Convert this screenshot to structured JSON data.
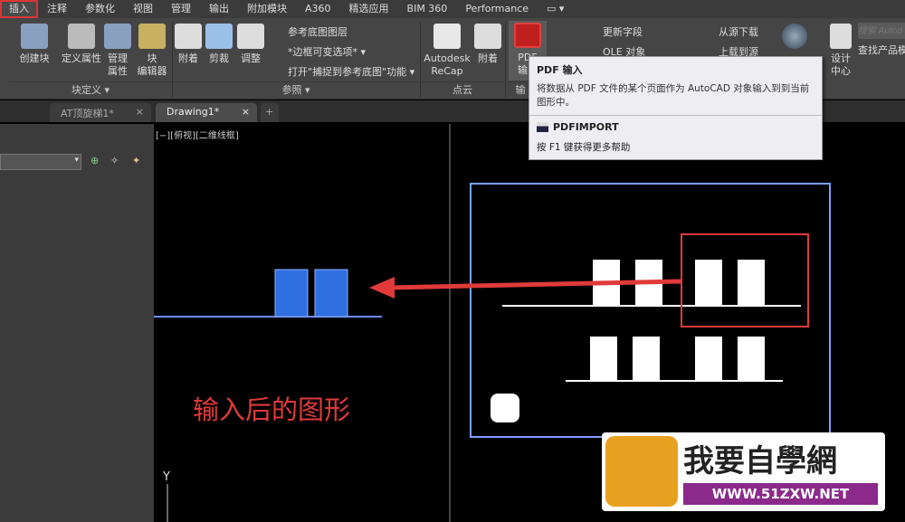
{
  "menu": {
    "tabs": [
      "插入",
      "注释",
      "参数化",
      "视图",
      "管理",
      "输出",
      "附加模块",
      "A360",
      "精选应用",
      "BIM 360",
      "Performance"
    ],
    "active": "插入"
  },
  "ribbon": {
    "block_def": {
      "create": "创建块",
      "define_attr": "定义属性",
      "manage_attr": "管理\n属性",
      "block_editor": "块\n编辑器",
      "label": "块定义 ▾"
    },
    "reference": {
      "attach": "附着",
      "clip": "剪裁",
      "adjust": "调整",
      "underlay_layers": "参考底图图层",
      "frame": "*边框可变选项* ▾",
      "snap": "打开\"捕捉到参考底图\"功能 ▾",
      "label": "参照 ▾"
    },
    "pointcloud": {
      "recap": "Autodesk\nReCap",
      "attach": "附着",
      "label": "点云"
    },
    "import": {
      "pdf": "PDF\n输入",
      "label": "输"
    },
    "data": {
      "update_fields": "更新字段",
      "ole": "OLE 对象"
    },
    "linking": {
      "download": "从源下载",
      "upload": "上载到源"
    },
    "content": {
      "design_center": "设计\n中心",
      "search_placeholder": "搜索 Autod",
      "find": "查找产品模"
    }
  },
  "filetabs": [
    "AT顶旋梯1*",
    "Drawing1*"
  ],
  "viewport_label": "[−][俯视][二维线框]",
  "tooltip": {
    "title": "PDF 输入",
    "desc": "将数据从 PDF 文件的某个页面作为 AutoCAD 对象输入到到当前图形中。",
    "command": "PDFIMPORT",
    "help": "按 F1 键获得更多帮助"
  },
  "annotation": "输入后的图形",
  "ucs_y": "Y",
  "watermark": {
    "text": "我要自學網",
    "url": "WWW.51ZXW.NET"
  },
  "colors": {
    "accent_red": "#e03a3a",
    "selection_blue": "#2f6fe0",
    "frame_blue": "#7aa0ff"
  }
}
